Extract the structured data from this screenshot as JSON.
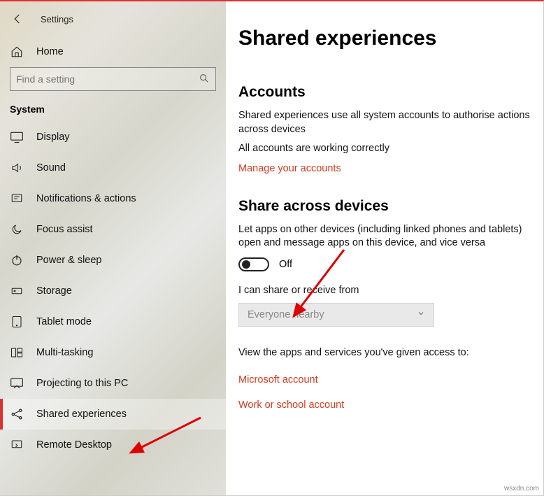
{
  "app": {
    "title": "Settings"
  },
  "sidebar": {
    "home_label": "Home",
    "search_placeholder": "Find a setting",
    "section_label": "System",
    "items": [
      {
        "label": "Display",
        "icon": "display-icon"
      },
      {
        "label": "Sound",
        "icon": "sound-icon"
      },
      {
        "label": "Notifications & actions",
        "icon": "notifications-icon"
      },
      {
        "label": "Focus assist",
        "icon": "moon-icon"
      },
      {
        "label": "Power & sleep",
        "icon": "power-icon"
      },
      {
        "label": "Storage",
        "icon": "storage-icon"
      },
      {
        "label": "Tablet mode",
        "icon": "tablet-icon"
      },
      {
        "label": "Multi-tasking",
        "icon": "multitask-icon"
      },
      {
        "label": "Projecting to this PC",
        "icon": "project-icon"
      },
      {
        "label": "Shared experiences",
        "icon": "share-icon",
        "selected": true
      },
      {
        "label": "Remote Desktop",
        "icon": "remote-icon"
      }
    ]
  },
  "main": {
    "heading": "Shared experiences",
    "accounts": {
      "heading": "Accounts",
      "desc": "Shared experiences use all system accounts to authorise actions across devices",
      "status": "All accounts are working correctly",
      "manage_link": "Manage your accounts"
    },
    "share": {
      "heading": "Share across devices",
      "desc": "Let apps on other devices (including linked phones and tablets) open and message apps on this device, and vice versa",
      "toggle_state": "Off",
      "receive_label": "I can share or receive from",
      "receive_value": "Everyone nearby",
      "access_label": "View the apps and services you've given access to:",
      "ms_account_link": "Microsoft account",
      "work_account_link": "Work or school account"
    }
  },
  "watermark": "wsxdn.com"
}
